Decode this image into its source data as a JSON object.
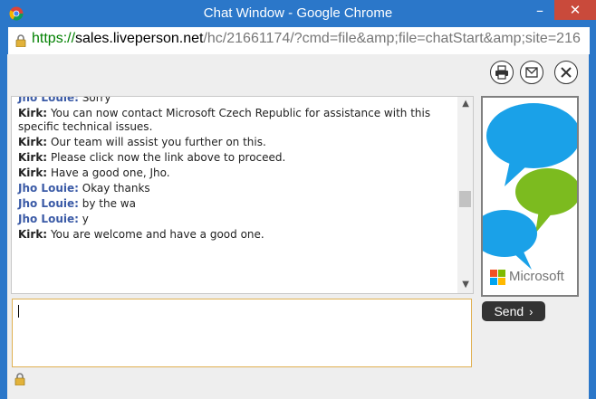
{
  "window": {
    "title": "Chat Window - Google Chrome",
    "minimize_label": "–",
    "close_label": "✕"
  },
  "address": {
    "scheme": "https://",
    "host": "sales.liveperson.net",
    "path": "/hc/21661174/?cmd=file&amp;file=chatStart&amp;site=216"
  },
  "toolbar": {
    "icons": [
      "print-icon",
      "email-icon",
      "close-icon"
    ]
  },
  "transcript": [
    {
      "speaker": "Jho Louie:",
      "role": "visitor",
      "text": "Sorry"
    },
    {
      "speaker": "Kirk:",
      "role": "agent",
      "text": "You can now contact Microsoft Czech Republic for assistance with this specific technical issues."
    },
    {
      "speaker": "Kirk:",
      "role": "agent",
      "text": "Our team will assist you further on this."
    },
    {
      "speaker": "Kirk:",
      "role": "agent",
      "text": "Please click now the link above to proceed."
    },
    {
      "speaker": "Kirk:",
      "role": "agent",
      "text": "Have a good one, Jho."
    },
    {
      "speaker": "Jho Louie:",
      "role": "visitor",
      "text": "Okay thanks"
    },
    {
      "speaker": "Jho Louie:",
      "role": "visitor",
      "text": "by the wa"
    },
    {
      "speaker": "Jho Louie:",
      "role": "visitor",
      "text": "y"
    },
    {
      "speaker": "Kirk:",
      "role": "agent",
      "text": "You are welcome and have a good one."
    }
  ],
  "ad": {
    "brand": "Microsoft",
    "colors": {
      "blue": "#1aa1e8",
      "green": "#7cbb1f",
      "ms_red": "#f25022",
      "ms_green": "#7fba00",
      "ms_blue": "#00a4ef",
      "ms_yellow": "#ffb900"
    }
  },
  "input": {
    "value": "",
    "placeholder": ""
  },
  "send": {
    "label": "Send",
    "arrow": "›"
  },
  "colors": {
    "titlebar": "#2b77c9",
    "visitor_name": "#3a5aa6",
    "input_border": "#e0b050"
  }
}
